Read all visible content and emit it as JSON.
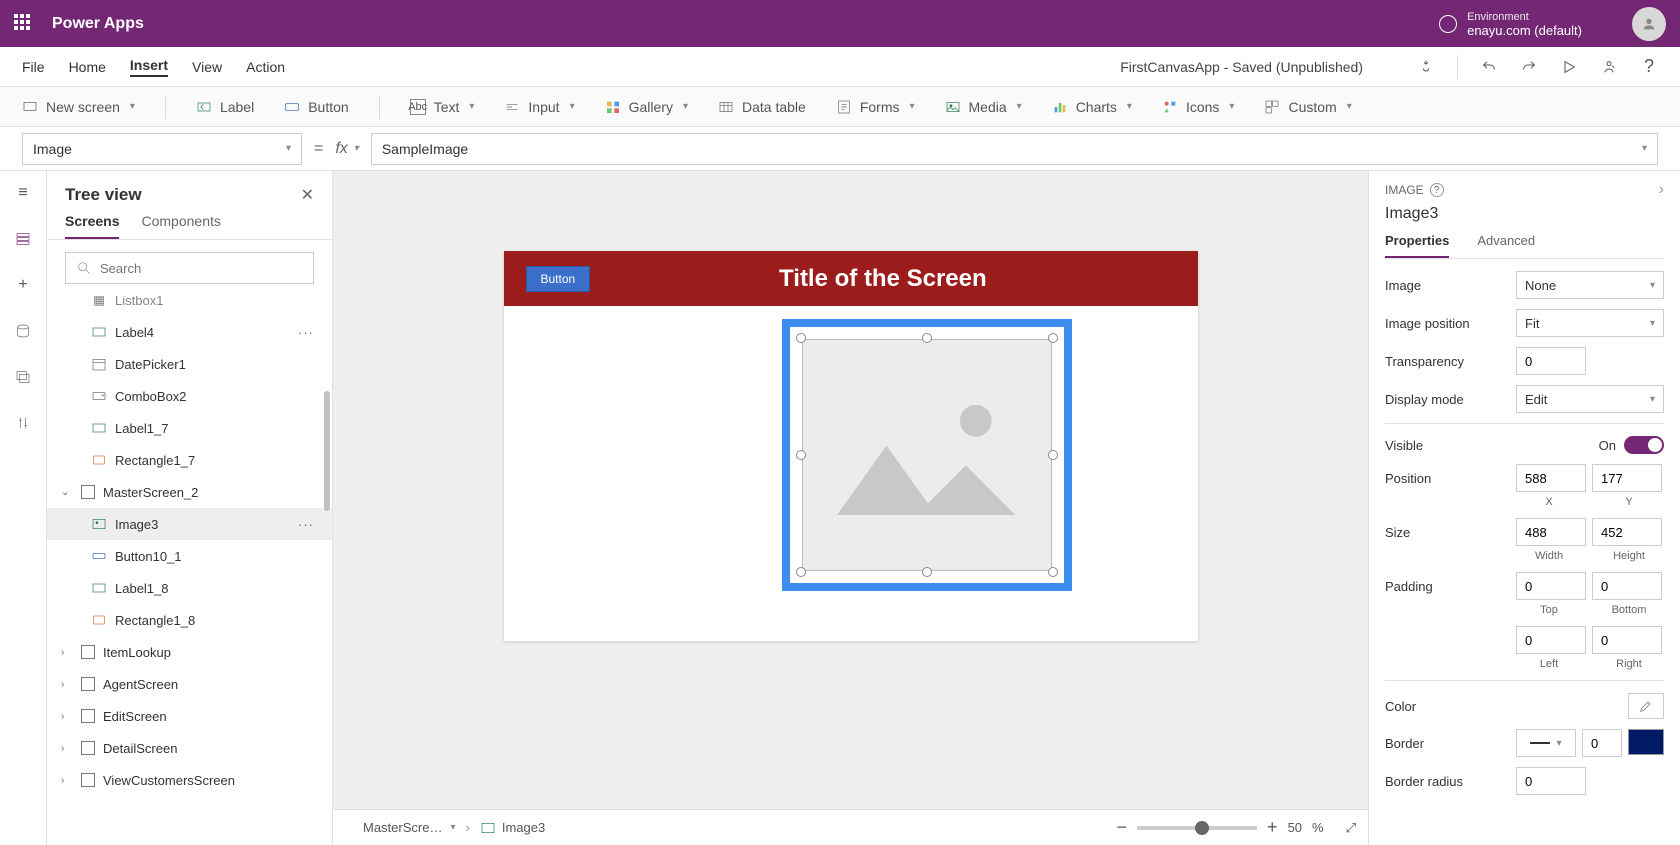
{
  "topbar": {
    "brand": "Power Apps",
    "env_label": "Environment",
    "env_value": "enayu.com (default)"
  },
  "menubar": {
    "items": [
      "File",
      "Home",
      "Insert",
      "View",
      "Action"
    ],
    "active": "Insert",
    "app_status": "FirstCanvasApp - Saved (Unpublished)"
  },
  "ribbon": {
    "newscreen": "New screen",
    "label": "Label",
    "button": "Button",
    "text": "Text",
    "input": "Input",
    "gallery": "Gallery",
    "datatable": "Data table",
    "forms": "Forms",
    "media": "Media",
    "charts": "Charts",
    "icons": "Icons",
    "custom": "Custom"
  },
  "formulabar": {
    "property": "Image",
    "fx": "fx",
    "value": "SampleImage"
  },
  "tree": {
    "title": "Tree view",
    "tabs": [
      "Screens",
      "Components"
    ],
    "search_placeholder": "Search",
    "items": [
      {
        "name": "Listbox1",
        "icon": "listbox",
        "indent": 2,
        "cut": true
      },
      {
        "name": "Label4",
        "icon": "label",
        "indent": 2,
        "dots": true
      },
      {
        "name": "DatePicker1",
        "icon": "date",
        "indent": 2
      },
      {
        "name": "ComboBox2",
        "icon": "combo",
        "indent": 2
      },
      {
        "name": "Label1_7",
        "icon": "label",
        "indent": 2
      },
      {
        "name": "Rectangle1_7",
        "icon": "rect",
        "indent": 2
      },
      {
        "name": "MasterScreen_2",
        "icon": "screen",
        "indent": 0,
        "expanded": true
      },
      {
        "name": "Image3",
        "icon": "image",
        "indent": 2,
        "selected": true,
        "dots": true
      },
      {
        "name": "Button10_1",
        "icon": "button",
        "indent": 2
      },
      {
        "name": "Label1_8",
        "icon": "label",
        "indent": 2
      },
      {
        "name": "Rectangle1_8",
        "icon": "rect",
        "indent": 2
      },
      {
        "name": "ItemLookup",
        "icon": "screen",
        "indent": 0,
        "collapsed": true
      },
      {
        "name": "AgentScreen",
        "icon": "screen",
        "indent": 0,
        "collapsed": true
      },
      {
        "name": "EditScreen",
        "icon": "screen",
        "indent": 0,
        "collapsed": true
      },
      {
        "name": "DetailScreen",
        "icon": "screen",
        "indent": 0,
        "collapsed": true
      },
      {
        "name": "ViewCustomersScreen",
        "icon": "screen",
        "indent": 0,
        "collapsed": true
      }
    ]
  },
  "canvas": {
    "button_label": "Button",
    "screen_title": "Title of the Screen",
    "breadcrumb1": "MasterScre…",
    "breadcrumb2": "Image3",
    "zoom": "50",
    "zoom_unit": "%"
  },
  "properties": {
    "type": "IMAGE",
    "name": "Image3",
    "tabs": [
      "Properties",
      "Advanced"
    ],
    "image": {
      "label": "Image",
      "value": "None"
    },
    "image_position": {
      "label": "Image position",
      "value": "Fit"
    },
    "transparency": {
      "label": "Transparency",
      "value": "0"
    },
    "display_mode": {
      "label": "Display mode",
      "value": "Edit"
    },
    "visible": {
      "label": "Visible",
      "value": "On"
    },
    "position": {
      "label": "Position",
      "x": "588",
      "y": "177",
      "xl": "X",
      "yl": "Y"
    },
    "size": {
      "label": "Size",
      "w": "488",
      "h": "452",
      "wl": "Width",
      "hl": "Height"
    },
    "padding": {
      "label": "Padding",
      "top": "0",
      "bottom": "0",
      "left": "0",
      "right": "0",
      "topl": "Top",
      "bottoml": "Bottom",
      "leftl": "Left",
      "rightl": "Right"
    },
    "color": {
      "label": "Color"
    },
    "border": {
      "label": "Border",
      "value": "0"
    },
    "border_radius": {
      "label": "Border radius",
      "value": "0"
    }
  }
}
